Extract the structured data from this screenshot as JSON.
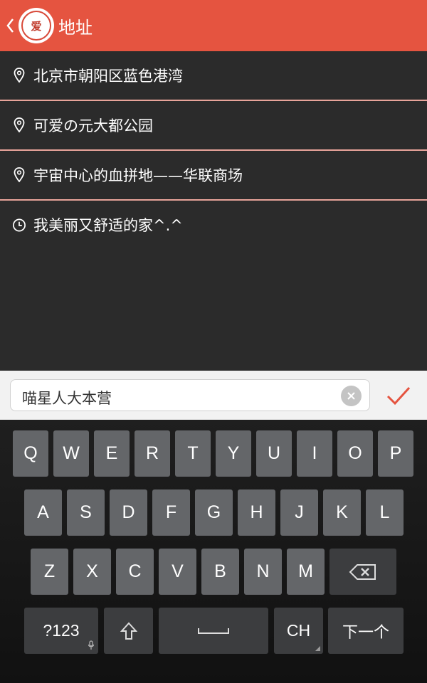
{
  "header": {
    "logo_text": "爱",
    "title": "地址"
  },
  "addresses": [
    {
      "icon": "location-pin-icon",
      "text": "北京市朝阳区蓝色港湾"
    },
    {
      "icon": "location-pin-icon",
      "text": "可爱の元大都公园"
    },
    {
      "icon": "location-pin-icon",
      "text": "宇宙中心的血拼地——华联商场"
    },
    {
      "icon": "clock-icon",
      "text": "我美丽又舒适的家^.^"
    }
  ],
  "input": {
    "value": "喵星人大本营"
  },
  "keyboard": {
    "row1": [
      "Q",
      "W",
      "E",
      "R",
      "T",
      "Y",
      "U",
      "I",
      "O",
      "P"
    ],
    "row2": [
      "A",
      "S",
      "D",
      "F",
      "G",
      "H",
      "J",
      "K",
      "L"
    ],
    "row3": [
      "Z",
      "X",
      "C",
      "V",
      "B",
      "N",
      "M"
    ],
    "numbers_label": "?123",
    "lang_label": "CH",
    "next_label": "下一个"
  },
  "colors": {
    "accent": "#e55440",
    "background": "#2b2b2b",
    "divider": "#e8a49a"
  }
}
